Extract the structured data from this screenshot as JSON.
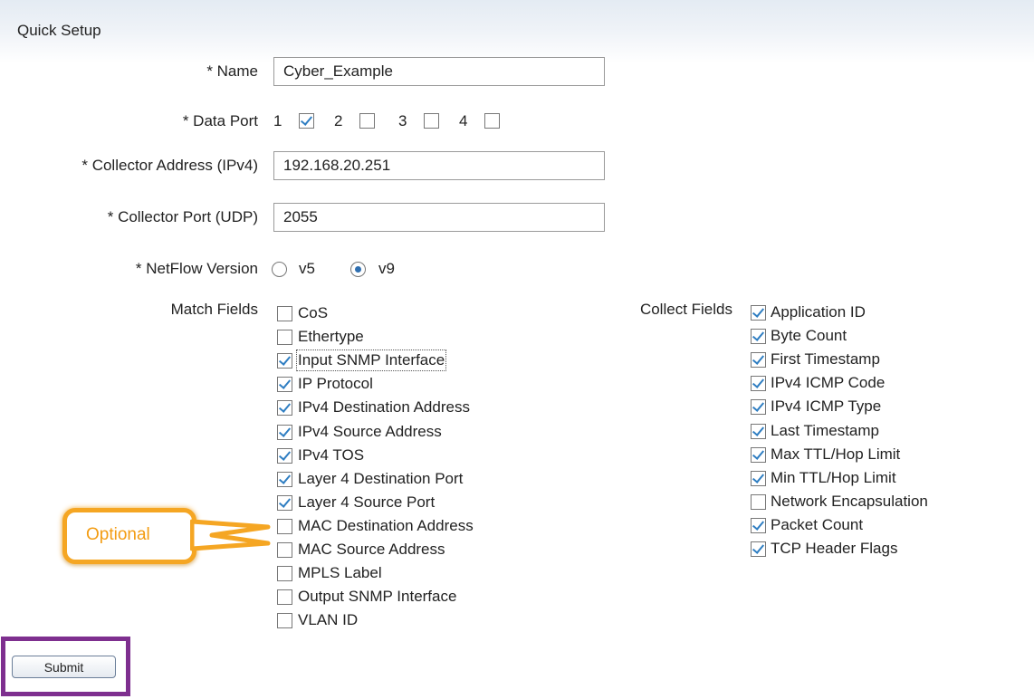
{
  "section_title": "Quick Setup",
  "name": {
    "label": "* Name",
    "value": "Cyber_Example"
  },
  "data_port": {
    "label": "* Data Port",
    "ports": [
      {
        "label": "1",
        "checked": true
      },
      {
        "label": "2",
        "checked": false
      },
      {
        "label": "3",
        "checked": false
      },
      {
        "label": "4",
        "checked": false
      }
    ]
  },
  "collector_address": {
    "label": "* Collector Address (IPv4)",
    "value": "192.168.20.251"
  },
  "collector_port": {
    "label": "* Collector Port (UDP)",
    "value": "2055"
  },
  "netflow_version": {
    "label": "* NetFlow Version",
    "options": [
      {
        "label": "v5",
        "selected": false
      },
      {
        "label": "v9",
        "selected": true
      }
    ]
  },
  "match_fields": {
    "label": "Match Fields",
    "items": [
      {
        "label": "CoS",
        "checked": false
      },
      {
        "label": "Ethertype",
        "checked": false
      },
      {
        "label": "Input SNMP Interface",
        "checked": true
      },
      {
        "label": "IP Protocol",
        "checked": true
      },
      {
        "label": "IPv4 Destination Address",
        "checked": true
      },
      {
        "label": "IPv4 Source Address",
        "checked": true
      },
      {
        "label": "IPv4 TOS",
        "checked": true
      },
      {
        "label": "Layer 4 Destination Port",
        "checked": true
      },
      {
        "label": "Layer 4 Source Port",
        "checked": true
      },
      {
        "label": "MAC Destination Address",
        "checked": false
      },
      {
        "label": "MAC Source Address",
        "checked": false
      },
      {
        "label": "MPLS Label",
        "checked": false
      },
      {
        "label": "Output SNMP Interface",
        "checked": false
      },
      {
        "label": "VLAN ID",
        "checked": false
      }
    ]
  },
  "collect_fields": {
    "label": "Collect Fields",
    "items": [
      {
        "label": "Application ID",
        "checked": true
      },
      {
        "label": "Byte Count",
        "checked": true
      },
      {
        "label": "First Timestamp",
        "checked": true
      },
      {
        "label": "IPv4 ICMP Code",
        "checked": true
      },
      {
        "label": "IPv4 ICMP Type",
        "checked": true
      },
      {
        "label": "Last Timestamp",
        "checked": true
      },
      {
        "label": "Max TTL/Hop Limit",
        "checked": true
      },
      {
        "label": "Min TTL/Hop Limit",
        "checked": true
      },
      {
        "label": "Network Encapsulation",
        "checked": false
      },
      {
        "label": "Packet Count",
        "checked": true
      },
      {
        "label": "TCP Header Flags",
        "checked": true
      }
    ]
  },
  "callout": {
    "text": "Optional"
  },
  "submit": {
    "label": "Submit"
  },
  "colors": {
    "check": "#2f7ec2",
    "callout_border": "#f5a623",
    "callout_text": "#f39c12",
    "submit_highlight": "#7e2f8f"
  }
}
